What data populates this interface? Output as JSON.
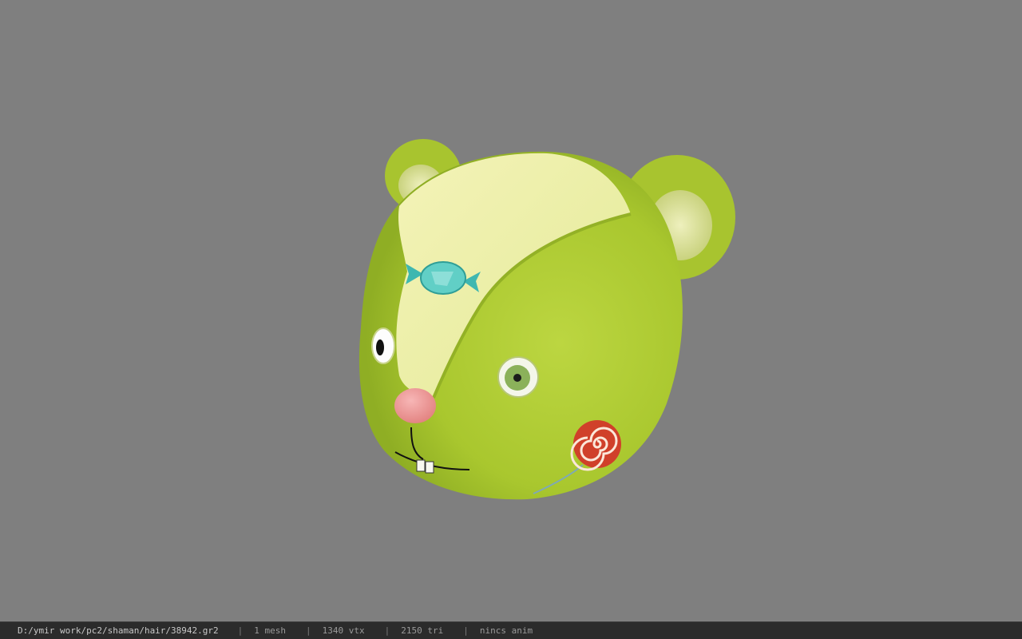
{
  "viewer": {
    "background_color": "#7f7f7f",
    "model_icon": "bear-head-model"
  },
  "status": {
    "file_path": "D:/ymir work/pc2/shaman/hair/38942.gr2",
    "separator": "|",
    "mesh": "1 mesh",
    "vertices": "1340 vtx",
    "triangles": "2150 tri",
    "anim": "nincs anim"
  }
}
